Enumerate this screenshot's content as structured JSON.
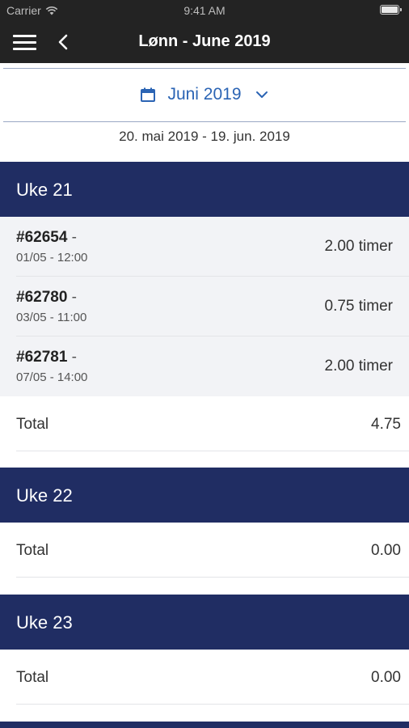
{
  "status_bar": {
    "carrier": "Carrier",
    "time": "9:41 AM"
  },
  "nav": {
    "title": "Lønn - June 2019"
  },
  "month": {
    "label": "Juni 2019",
    "range": "20. mai 2019 - 19. jun. 2019"
  },
  "weeks": [
    {
      "title": "Uke 21",
      "entries": [
        {
          "id": "#62654",
          "dash": " -",
          "when": "01/05 - 12:00",
          "hours": "2.00 timer"
        },
        {
          "id": "#62780",
          "dash": " -",
          "when": "03/05 - 11:00",
          "hours": "0.75 timer"
        },
        {
          "id": "#62781",
          "dash": " -",
          "when": "07/05 - 14:00",
          "hours": "2.00 timer"
        }
      ],
      "total_label": "Total",
      "total": "4.75"
    },
    {
      "title": "Uke 22",
      "entries": [],
      "total_label": "Total",
      "total": "0.00"
    },
    {
      "title": "Uke 23",
      "entries": [],
      "total_label": "Total",
      "total": "0.00"
    }
  ],
  "colors": {
    "header_bg": "#232323",
    "week_header_bg": "#202d63",
    "accent": "#2b64b4"
  }
}
